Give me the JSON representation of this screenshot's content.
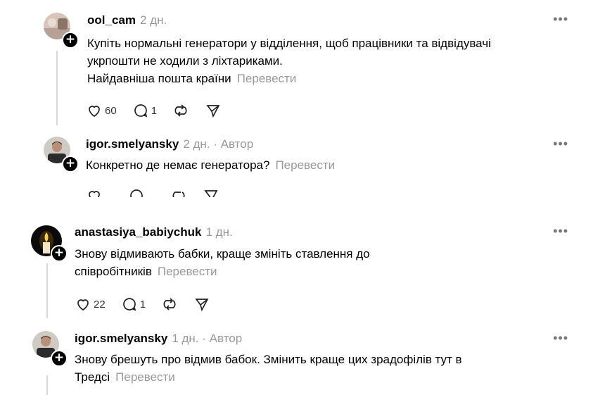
{
  "comments": [
    {
      "username": "ool_cam",
      "time": "2 дн.",
      "text_lines": [
        "Купіть нормальні генератори у відділення, щоб працівники та відвідувачі",
        "укрпошти не ходили з ліхтариками.",
        "Найдавніша пошта країни"
      ],
      "translate": "Перевести",
      "likes": "60",
      "replies": "1"
    },
    {
      "username": "igor.smelyansky",
      "time": "2 дн.",
      "author_label": "· Автор",
      "text_lines": [
        "Конкретно де немає генератора?"
      ],
      "translate": "Перевести"
    },
    {
      "username": "anastasiya_babiychuk",
      "time": "1 дн.",
      "text_lines": [
        "Знову відмивають бабки, краще змініть ставлення до",
        "співробітників"
      ],
      "translate": "Перевести",
      "likes": "22",
      "replies": "1"
    },
    {
      "username": "igor.smelyansky",
      "time": "1 дн.",
      "author_label": "· Автор",
      "text_lines": [
        "Знову брешуть про відмив бабок. Змінить краще цих зрадофілів тут в",
        "Тредсі"
      ],
      "translate": "Перевести"
    }
  ],
  "more_icon": "more-horizontal-icon",
  "colors": {
    "muted": "#999999",
    "line": "#d9d9d9",
    "plus_bg": "#000000"
  }
}
